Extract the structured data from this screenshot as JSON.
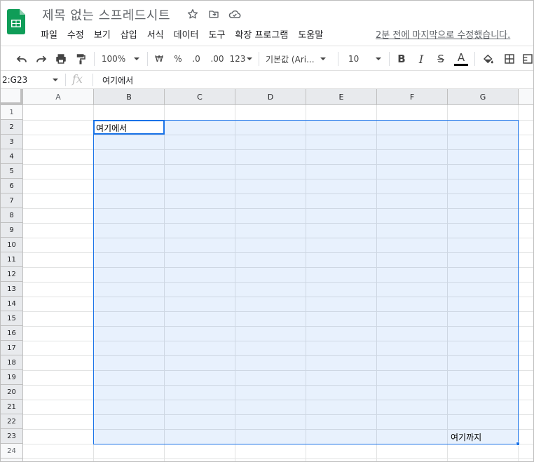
{
  "doc": {
    "title": "제목 없는 스프레드시트",
    "last_edit": "2분 전에 마지막으로 수정했습니다."
  },
  "menu": [
    "파일",
    "수정",
    "보기",
    "삽입",
    "서식",
    "데이터",
    "도구",
    "확장 프로그램",
    "도움말"
  ],
  "toolbar": {
    "zoom": "100%",
    "currency": "₩",
    "percent": "%",
    "dec_decrease": ".0",
    "dec_increase": ".00",
    "format_more": "123",
    "font": "기본값 (Ari...",
    "font_size": "10",
    "bold": "B",
    "italic": "I",
    "strike": "S",
    "text_color": "A"
  },
  "formula_bar": {
    "name_box": "2:G23",
    "fx": "fx",
    "content": "여기에서"
  },
  "grid": {
    "columns": [
      "A",
      "B",
      "C",
      "D",
      "E",
      "F",
      "G"
    ],
    "rows": [
      "1",
      "2",
      "3",
      "4",
      "5",
      "6",
      "7",
      "8",
      "9",
      "10",
      "11",
      "12",
      "13",
      "14",
      "15",
      "16",
      "17",
      "18",
      "19",
      "20",
      "21",
      "22",
      "23",
      "24"
    ],
    "cell_b2": "여기에서",
    "cell_g23": "여기까지"
  },
  "colors": {
    "accent": "#1a73e8",
    "sheets_green": "#0f9d58"
  }
}
